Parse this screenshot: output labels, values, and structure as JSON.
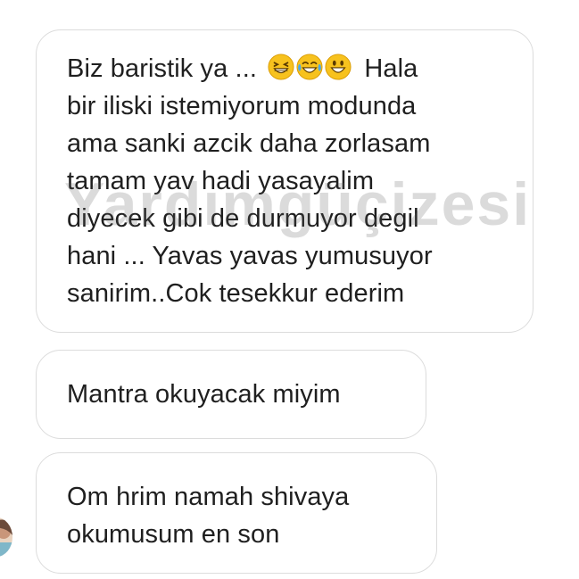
{
  "conversation": {
    "messages": [
      {
        "lines": [
          "Biz baristik ya ...",
          "bir iliski istemiyorum modunda",
          "ama sanki azcik daha zorlasam",
          "tamam yav hadi yasayalim",
          "diyecek gibi de durmuyor degil",
          "hani ... Yavas yavas yumusuyor",
          "sanirim..Cok tesekkur ederim"
        ],
        "after_emoji": "Hala",
        "emojis": [
          "grinning-squint-emoji",
          "tears-of-joy-emoji",
          "grinning-smile-emoji"
        ]
      },
      {
        "lines": [
          "Mantra okuyacak miyim"
        ]
      },
      {
        "lines": [
          "Om hrim namah shivaya",
          "okumusum en son"
        ]
      }
    ]
  },
  "watermark": {
    "text": "Yardımgüçizesi"
  },
  "colors": {
    "bubble_border": "#dcdcdc",
    "text": "#1f1f1f",
    "emoji_yellow": "#f7c21e",
    "tear_blue": "#4aa8e8"
  }
}
